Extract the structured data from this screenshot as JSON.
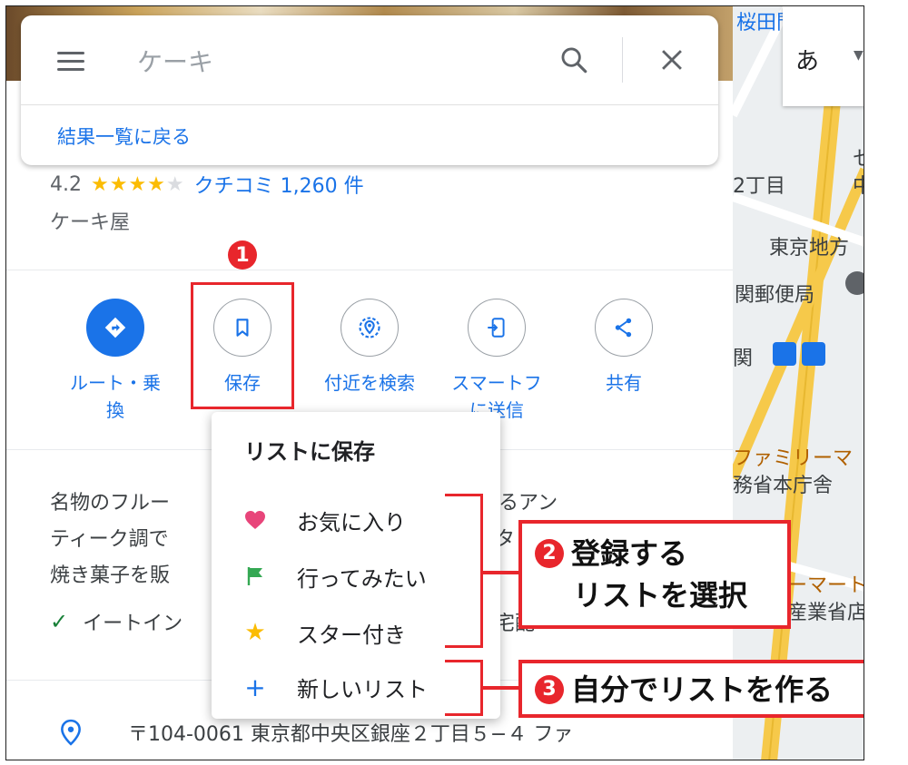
{
  "search": {
    "query": "ケーキ",
    "back_label": "結果一覧に戻る"
  },
  "place": {
    "rating": "4.2",
    "stars": "★★★★",
    "stars_empty": "★",
    "reviews": "クチコミ 1,260 件",
    "category": "ケーキ屋"
  },
  "actions": [
    {
      "label_line1": "ルート・乗",
      "label_line2": "換"
    },
    {
      "label_line1": "保存",
      "label_line2": ""
    },
    {
      "label_line1": "付近を検索",
      "label_line2": ""
    },
    {
      "label_line1": "スマートフ",
      "label_line2": "に送信"
    },
    {
      "label_line1": "共有",
      "label_line2": ""
    }
  ],
  "description": {
    "line1a": "名物のフルー",
    "line1b": "供するアン",
    "line2a": "ティーク調で",
    "line2b": "タ",
    "line3a": "焼き菓子を販",
    "feature": "イートイン",
    "feature_tail": "宅配"
  },
  "address": "〒104-0061 東京都中央区銀座２丁目５−４ ファ",
  "save_menu": {
    "title": "リストに保存",
    "items": [
      {
        "label": "お気に入り",
        "icon": "heart-icon",
        "color": "#e8457a"
      },
      {
        "label": "行ってみたい",
        "icon": "flag-icon",
        "color": "#34a853"
      },
      {
        "label": "スター付き",
        "icon": "star-icon",
        "color": "#fbbc04"
      },
      {
        "label": "新しいリスト",
        "icon": "plus-icon",
        "color": "#1a73e8"
      }
    ]
  },
  "annotations": {
    "badge1": "1",
    "badge2": "2",
    "badge3": "3",
    "callout2_line1": "登録する",
    "callout2_line2": "リストを選択",
    "callout3": "自分でリストを作る"
  },
  "map": {
    "ime_label": "あ",
    "labels": [
      "桜田門",
      "2丁目",
      "東京地方",
      "関郵便局",
      "関",
      "ファミリーマ",
      "務省本庁舎",
      "ーマート",
      "産業省店",
      "セ",
      "中"
    ]
  },
  "colors": {
    "accent": "#1a73e8",
    "annotation_red": "#e8262c",
    "star": "#fbbc04"
  }
}
